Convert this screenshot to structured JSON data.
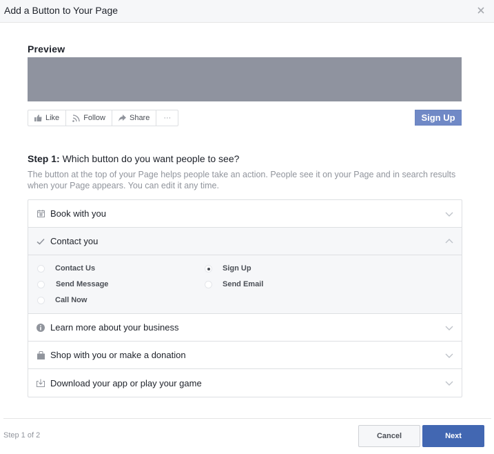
{
  "dialog": {
    "title": "Add a Button to Your Page",
    "close_icon": "close-icon"
  },
  "preview": {
    "label": "Preview",
    "actions": [
      {
        "icon": "thumbs-up-icon",
        "label": "Like"
      },
      {
        "icon": "rss-icon",
        "label": "Follow"
      },
      {
        "icon": "share-arrow-icon",
        "label": "Share"
      },
      {
        "icon": "more-dots-icon",
        "label": "···"
      }
    ],
    "cta_button": "Sign Up",
    "cta_color": "#7089c6"
  },
  "step": {
    "title_bold": "Step 1:",
    "title_rest": " Which button do you want people to see?",
    "description": "The button at the top of your Page helps people take an action. People see it on your Page and in search results when your Page appears. You can edit it any time."
  },
  "categories": [
    {
      "icon": "calendar-icon",
      "label": "Book with you",
      "expanded": false
    },
    {
      "icon": "checkmark-icon",
      "label": "Contact you",
      "expanded": true
    },
    {
      "icon": "info-icon",
      "label": "Learn more about your business",
      "expanded": false
    },
    {
      "icon": "shopping-bag-icon",
      "label": "Shop with you or make a donation",
      "expanded": false
    },
    {
      "icon": "download-icon",
      "label": "Download your app or play your game",
      "expanded": false
    }
  ],
  "contact_options": [
    {
      "label": "Contact Us",
      "selected": false
    },
    {
      "label": "Send Message",
      "selected": false
    },
    {
      "label": "Call Now",
      "selected": false
    },
    {
      "label": "Sign Up",
      "selected": true
    },
    {
      "label": "Send Email",
      "selected": false
    }
  ],
  "footer": {
    "step_indicator": "Step 1 of 2",
    "cancel_label": "Cancel",
    "next_label": "Next",
    "next_color": "#4267b2"
  }
}
